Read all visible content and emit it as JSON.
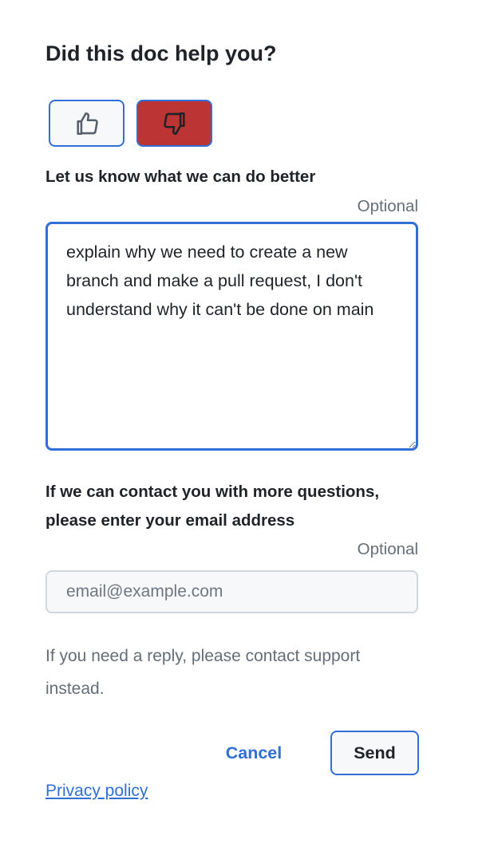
{
  "title": "Did this doc help you?",
  "vote": {
    "up_icon": "thumbs-up-icon",
    "down_icon": "thumbs-down-icon",
    "selected": "down",
    "selected_color": "#bd3434"
  },
  "feedback": {
    "label": "Let us know what we can do better",
    "optional": "Optional",
    "value": "explain why we need to create a new branch and make a pull request, I don't understand why it can't be done on main"
  },
  "email": {
    "label": "If we can contact you with more questions, please enter your email address",
    "optional": "Optional",
    "placeholder": "email@example.com"
  },
  "help_text": "If you need a reply, please contact support instead.",
  "actions": {
    "cancel": "Cancel",
    "send": "Send"
  },
  "privacy_link": "Privacy policy",
  "accent_color": "#2f6fd6"
}
